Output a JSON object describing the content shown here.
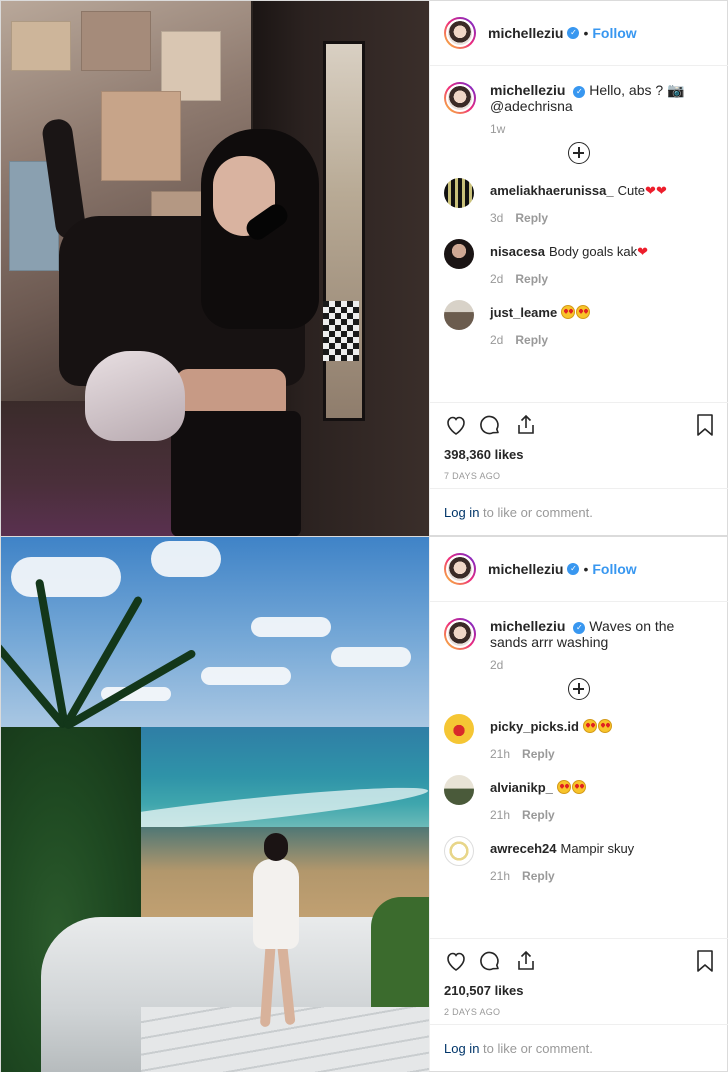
{
  "posts": [
    {
      "header": {
        "username": "michelleziu",
        "dot": "•",
        "follow": "Follow"
      },
      "caption": {
        "username": "michelleziu",
        "text": "Hello, abs ? 📷 @adechrisna",
        "time": "1w"
      },
      "comments": [
        {
          "username": "ameliakhaerunissa_",
          "text": "Cute",
          "time": "3d",
          "reply": "Reply"
        },
        {
          "username": "nisacesa",
          "text": "Body goals kak",
          "time": "2d",
          "reply": "Reply"
        },
        {
          "username": "just_leame",
          "text": "",
          "time": "2d",
          "reply": "Reply"
        }
      ],
      "likes": "398,360 likes",
      "date": "7 DAYS AGO",
      "login_link": "Log in",
      "login_rest": " to like or comment."
    },
    {
      "header": {
        "username": "michelleziu",
        "dot": "•",
        "follow": "Follow"
      },
      "caption": {
        "username": "michelleziu",
        "text": "Waves on the sands arrr washing",
        "time": "2d"
      },
      "comments": [
        {
          "username": "picky_picks.id",
          "text": "",
          "time": "21h",
          "reply": "Reply"
        },
        {
          "username": "alvianikp_",
          "text": "",
          "time": "21h",
          "reply": "Reply"
        },
        {
          "username": "awreceh24",
          "text": "Mampir skuy",
          "time": "21h",
          "reply": "Reply"
        }
      ],
      "likes": "210,507 likes",
      "date": "2 DAYS AGO",
      "login_link": "Log in",
      "login_rest": " to like or comment."
    }
  ],
  "icons": [
    "verified-badge-icon",
    "heart-icon",
    "comment-icon",
    "share-icon",
    "bookmark-icon",
    "load-more-icon",
    "heart-eyes-emoji-icon",
    "red-heart-icon"
  ],
  "colors": {
    "link_blue": "#3897f0",
    "dark_link": "#003569",
    "muted": "#999999",
    "heart_red": "#ed1e2c"
  }
}
